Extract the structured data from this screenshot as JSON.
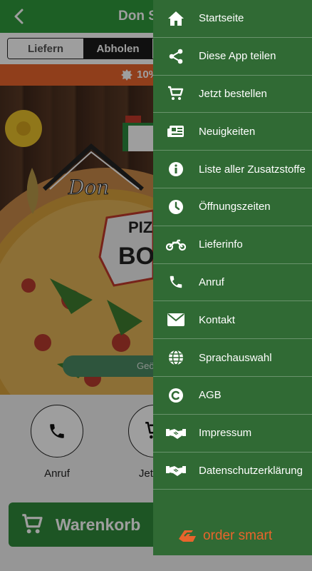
{
  "app": {
    "title": "Don Sa",
    "mode_tabs": [
      {
        "label": "Liefern"
      },
      {
        "label": "Abholen"
      }
    ],
    "promo_text": "10%",
    "hero_logo_text": "Don",
    "hero_badge_lines": [
      "PIZ",
      "BO"
    ],
    "geo_button_label": "Geö",
    "actions": [
      {
        "label": "Anruf",
        "icon": "phone-icon"
      },
      {
        "label": "Jetzt b",
        "icon": "cart-icon"
      }
    ],
    "cart_button_label": "Warenkorb"
  },
  "drawer": {
    "items": [
      {
        "label": "Startseite",
        "icon": "home-icon"
      },
      {
        "label": "Diese App teilen",
        "icon": "share-icon"
      },
      {
        "label": "Jetzt bestellen",
        "icon": "cart-icon"
      },
      {
        "label": "Neuigkeiten",
        "icon": "newspaper-icon"
      },
      {
        "label": "Liste aller Zusatzstoffe",
        "icon": "info-icon"
      },
      {
        "label": "Öffnungszeiten",
        "icon": "clock-icon"
      },
      {
        "label": "Lieferinfo",
        "icon": "motorcycle-icon"
      },
      {
        "label": "Anruf",
        "icon": "phone-icon"
      },
      {
        "label": "Kontakt",
        "icon": "envelope-icon"
      },
      {
        "label": "Sprachauswahl",
        "icon": "globe-icon"
      },
      {
        "label": "AGB",
        "icon": "copyright-icon"
      },
      {
        "label": "Impressum",
        "icon": "handshake-icon"
      },
      {
        "label": "Datenschutzerklärung",
        "icon": "handshake-icon"
      }
    ],
    "brand_text": "order smart"
  },
  "colors": {
    "topbar": "#2f9a3c",
    "drawer": "#306a34",
    "promo": "#e8642c",
    "brand": "#e8642c"
  }
}
